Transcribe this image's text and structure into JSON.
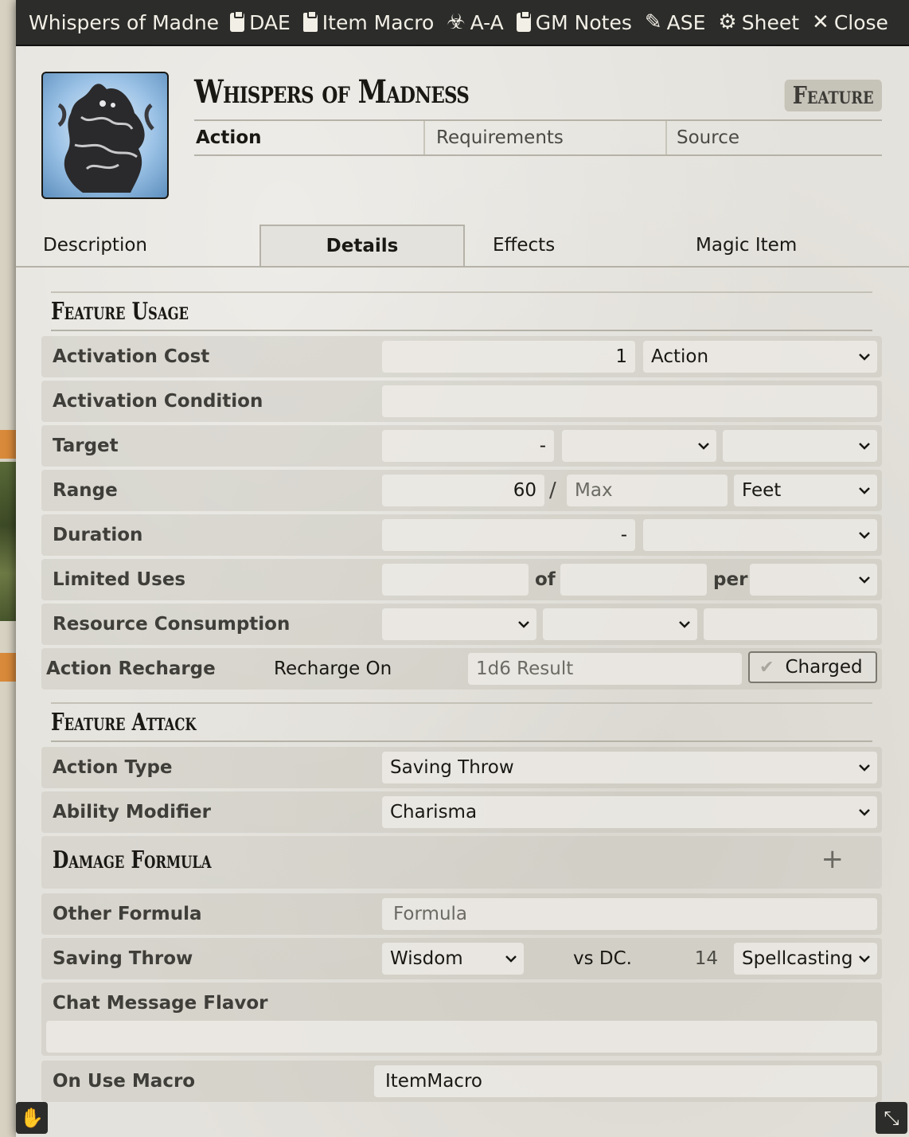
{
  "window": {
    "title": "Whispers of Madne",
    "header_buttons": [
      {
        "label": "DAE",
        "icon": "clipboard-icon"
      },
      {
        "label": "Item Macro",
        "icon": "sd-card-icon"
      },
      {
        "label": "A-A",
        "icon": "biohazard-icon"
      },
      {
        "label": "GM Notes",
        "icon": "clipboard-icon"
      },
      {
        "label": "ASE",
        "icon": "magic-wand-icon"
      },
      {
        "label": "Sheet",
        "icon": "gear-icon"
      },
      {
        "label": "Close",
        "icon": "close-icon"
      }
    ]
  },
  "item": {
    "name": "Whispers of Madness",
    "type": "Feature",
    "summary": {
      "activation": "Action",
      "requirements": "Requirements",
      "source": "Source"
    }
  },
  "tabs": [
    "Description",
    "Details",
    "Effects",
    "Magic Item"
  ],
  "active_tab": "Details",
  "feature_usage": {
    "heading": "Feature Usage",
    "activation_cost": {
      "label": "Activation Cost",
      "value": "1",
      "type": "Action"
    },
    "activation_condition": {
      "label": "Activation Condition",
      "value": ""
    },
    "target": {
      "label": "Target",
      "value": "-",
      "units": "",
      "type": ""
    },
    "range": {
      "label": "Range",
      "value": "60",
      "slash": "/",
      "max_placeholder": "Max",
      "units": "Feet"
    },
    "duration": {
      "label": "Duration",
      "value": "-",
      "units": ""
    },
    "limited_uses": {
      "label": "Limited Uses",
      "value": "",
      "of": "of",
      "max": "",
      "per_label": "per",
      "per": ""
    },
    "resource_consumption": {
      "label": "Resource Consumption",
      "type": "",
      "target": "",
      "amount": ""
    },
    "action_recharge": {
      "label": "Action Recharge",
      "recharge_on": "Recharge On",
      "placeholder": "1d6 Result",
      "charged": "Charged"
    }
  },
  "feature_attack": {
    "heading": "Feature Attack",
    "action_type": {
      "label": "Action Type",
      "value": "Saving Throw"
    },
    "ability_modifier": {
      "label": "Ability Modifier",
      "value": "Charisma"
    }
  },
  "damage_formula": {
    "heading": "Damage Formula",
    "add_icon": "plus-icon",
    "other_formula": {
      "label": "Other Formula",
      "placeholder": "Formula"
    },
    "saving_throw": {
      "label": "Saving Throw",
      "ability": "Wisdom",
      "vs": "vs DC.",
      "dc": "14",
      "scaling": "Spellcasting"
    },
    "chat_flavor": {
      "label": "Chat Message Flavor",
      "value": ""
    },
    "on_use_macro": {
      "label": "On Use Macro",
      "value": "ItemMacro"
    }
  },
  "colors": {
    "titlebar": "#2c2c2a",
    "parchment": "#e4e2dc",
    "accent_orange": "#d98a3a"
  }
}
